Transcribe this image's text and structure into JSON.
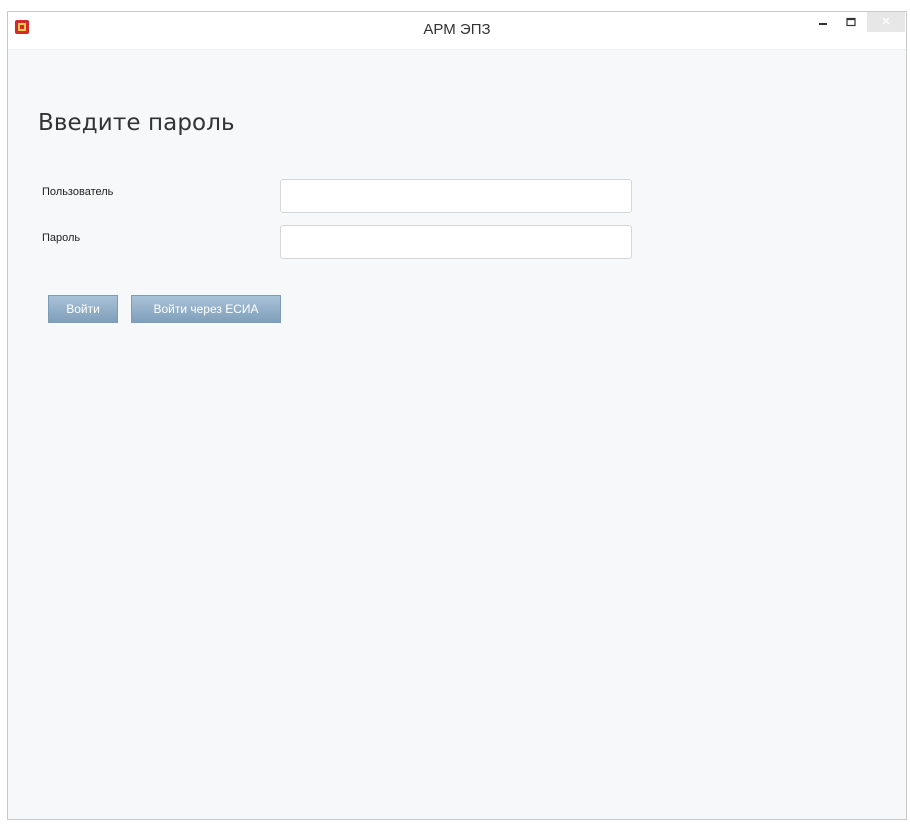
{
  "window": {
    "title": "АРМ ЭПЗ",
    "controls": {
      "minimize": "–",
      "maximize": "□",
      "close": "×"
    }
  },
  "form": {
    "heading": "Введите пароль",
    "user_label": "Пользователь",
    "user_value": "",
    "password_label": "Пароль",
    "password_value": ""
  },
  "buttons": {
    "login": "Войти",
    "login_esia": "Войти через ЕСИА"
  },
  "colors": {
    "button_top": "#a9c2d8",
    "button_bottom": "#809fbb",
    "app_icon": "#d22a2a",
    "background": "#f7f8f9"
  }
}
